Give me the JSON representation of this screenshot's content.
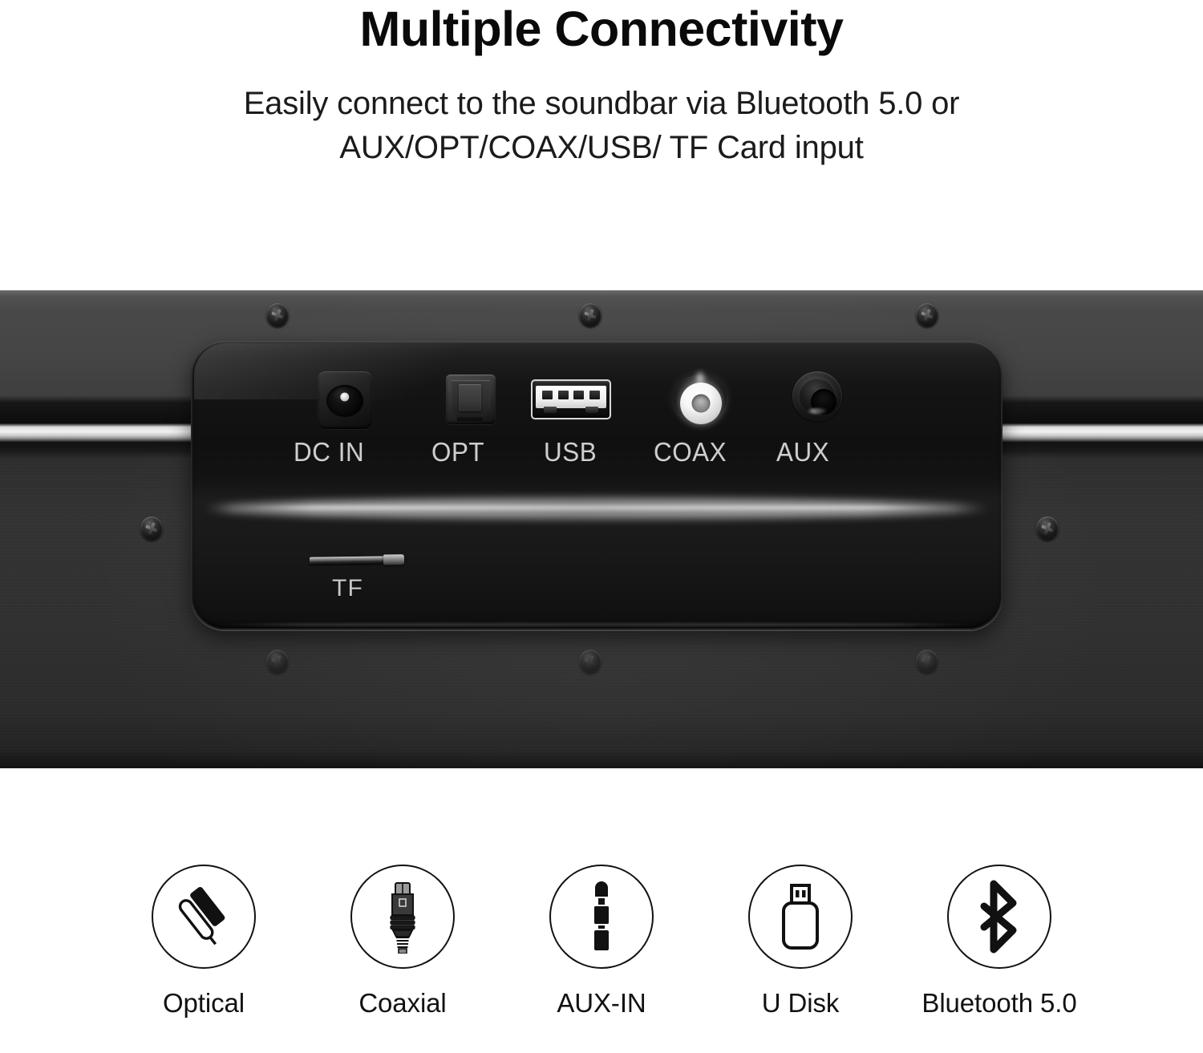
{
  "header": {
    "headline": "Multiple Connectivity",
    "subhead_line1": "Easily connect to the soundbar via Bluetooth 5.0 or",
    "subhead_line2": "AUX/OPT/COAX/USB/ TF Card input"
  },
  "product": {
    "type": "soundbar",
    "panel_label": "port panel",
    "ports": [
      {
        "id": "dc-in",
        "label": "DC IN",
        "icon": "dc-barrel-jack-port"
      },
      {
        "id": "opt",
        "label": "OPT",
        "icon": "toslink-optical-port"
      },
      {
        "id": "usb",
        "label": "USB",
        "icon": "usb-a-port"
      },
      {
        "id": "coax",
        "label": "COAX",
        "icon": "rca-coaxial-jack"
      },
      {
        "id": "aux",
        "label": "AUX",
        "icon": "aux-3p5mm-jack"
      }
    ],
    "card_slot": {
      "label": "TF",
      "icon": "tf-card-slot"
    }
  },
  "features": [
    {
      "label": "Optical",
      "icon": "optical-cable-icon"
    },
    {
      "label": "Coaxial",
      "icon": "coaxial-connector-icon"
    },
    {
      "label": "AUX-IN",
      "icon": "aux-plug-icon"
    },
    {
      "label": "U Disk",
      "icon": "usb-flash-drive-icon"
    },
    {
      "label": "Bluetooth 5.0",
      "icon": "bluetooth-icon"
    }
  ],
  "colors": {
    "background": "#ffffff",
    "text": "#0a0a0a",
    "soundbar_body": "#333333",
    "chrome_strip": "#f2f2f2",
    "port_label": "#cfcfcf",
    "icon_stroke": "#111111"
  }
}
